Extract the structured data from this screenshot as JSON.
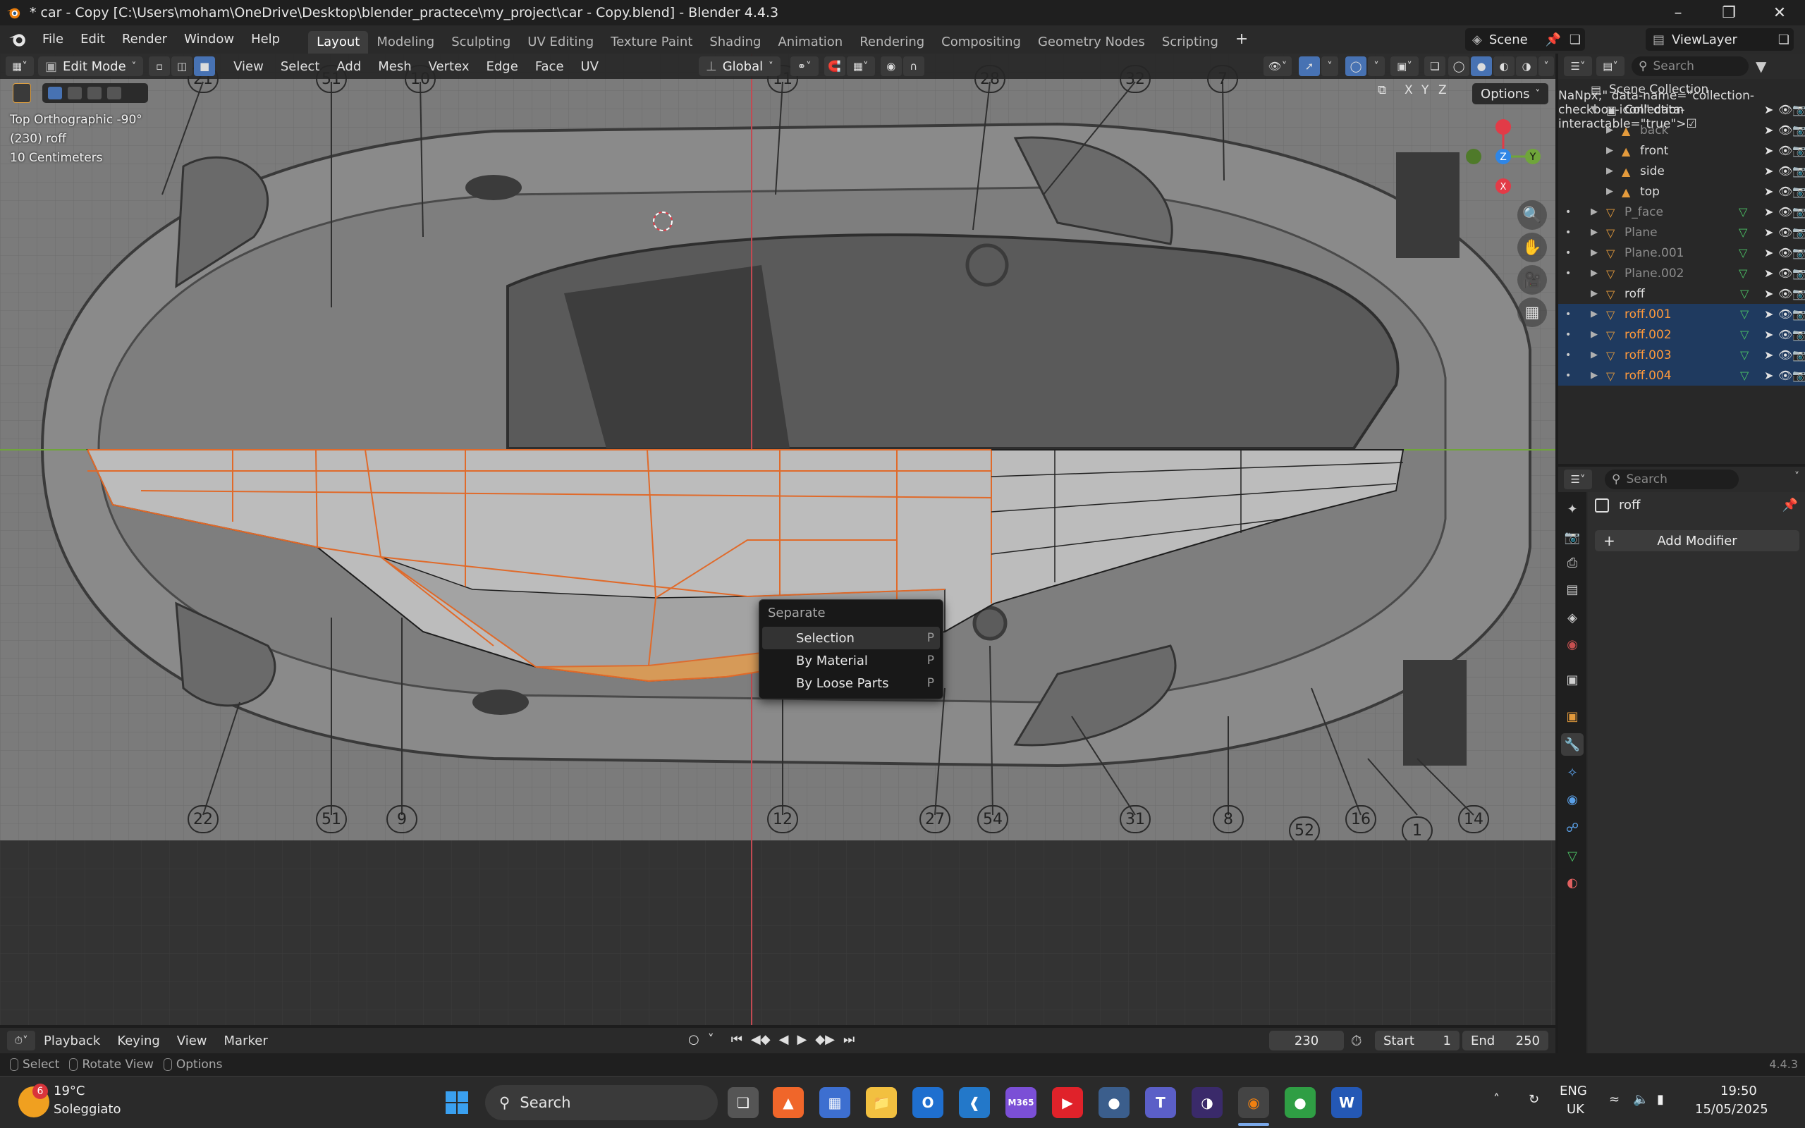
{
  "window": {
    "title": "* car - Copy [C:\\Users\\moham\\OneDrive\\Desktop\\blender_practece\\my_project\\car - Copy.blend] - Blender 4.4.3"
  },
  "menus": [
    "File",
    "Edit",
    "Render",
    "Window",
    "Help"
  ],
  "workspaces": [
    "Layout",
    "Modeling",
    "Sculpting",
    "UV Editing",
    "Texture Paint",
    "Shading",
    "Animation",
    "Rendering",
    "Compositing",
    "Geometry Nodes",
    "Scripting"
  ],
  "scene": {
    "name": "Scene",
    "view_layer": "ViewLayer"
  },
  "viewport": {
    "mode": "Edit Mode",
    "menus": [
      "View",
      "Select",
      "Add",
      "Mesh",
      "Vertex",
      "Edge",
      "Face",
      "UV"
    ],
    "orientation": "Global",
    "overlay_lines": [
      "Top Orthographic -90°",
      "(230) roff",
      "10 Centimeters"
    ],
    "options_label": "Options",
    "axis_toggles": [
      "X",
      "Y",
      "Z"
    ],
    "blueprint_numbers": [
      "21",
      "51",
      "10",
      "11",
      "28",
      "32",
      "7",
      "22",
      "51",
      "9",
      "12",
      "27",
      "54",
      "31",
      "8",
      "52",
      "16",
      "1",
      "14"
    ],
    "gizmo_axes": [
      "Z",
      "Y"
    ]
  },
  "context_menu": {
    "title": "Separate",
    "items": [
      {
        "label": "Selection",
        "key": "P"
      },
      {
        "label": "By Material",
        "key": "P"
      },
      {
        "label": "By Loose Parts",
        "key": "P"
      }
    ]
  },
  "timeline": {
    "menus": [
      "Playback",
      "Keying",
      "View",
      "Marker"
    ],
    "current_frame": "230",
    "start_label": "Start",
    "start": "1",
    "end_label": "End",
    "end": "250"
  },
  "status_bar": {
    "items": [
      "Select",
      "Rotate View",
      "Options"
    ],
    "version": "4.4.3"
  },
  "outliner": {
    "search_placeholder": "Search",
    "rows": [
      {
        "name": "Scene Collection",
        "style": "normal"
      },
      {
        "name": "Collection",
        "style": "normal"
      },
      {
        "name": "back",
        "style": "dim"
      },
      {
        "name": "front",
        "style": "normal"
      },
      {
        "name": "side",
        "style": "normal"
      },
      {
        "name": "top",
        "style": "normal"
      },
      {
        "name": "P_face",
        "style": "dim"
      },
      {
        "name": "Plane",
        "style": "dim"
      },
      {
        "name": "Plane.001",
        "style": "dim"
      },
      {
        "name": "Plane.002",
        "style": "dim"
      },
      {
        "name": "roff",
        "style": "normal"
      },
      {
        "name": "roff.001",
        "style": "orange"
      },
      {
        "name": "roff.002",
        "style": "orange"
      },
      {
        "name": "roff.003",
        "style": "orange"
      },
      {
        "name": "roff.004",
        "style": "orange"
      }
    ]
  },
  "properties": {
    "search_placeholder": "Search",
    "object_name": "roff",
    "add_modifier_label": "Add Modifier"
  },
  "taskbar": {
    "weather_temp": "19°C",
    "weather_desc": "Soleggiato",
    "weather_badge": "6",
    "search_label": "Search",
    "lang_top": "ENG",
    "lang_bottom": "UK",
    "time": "19:50",
    "date": "15/05/2025",
    "m365_label": "M365"
  },
  "colors": {
    "accent": "#4772b3",
    "selected_row": "#1f3a5f",
    "edge_orange": "#e06a2a",
    "axis_red": "#e23b47",
    "axis_green": "#6fa53a",
    "axis_blue": "#2f86e6"
  }
}
